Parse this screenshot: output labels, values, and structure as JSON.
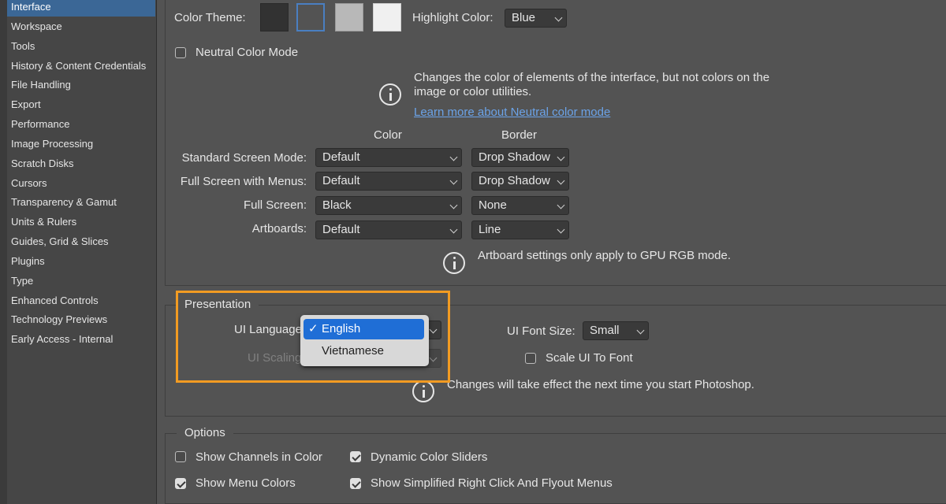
{
  "sidebar": {
    "items": [
      {
        "label": "Interface",
        "selected": true
      },
      {
        "label": "Workspace"
      },
      {
        "label": "Tools"
      },
      {
        "label": "History & Content Credentials"
      },
      {
        "label": "File Handling"
      },
      {
        "label": "Export"
      },
      {
        "label": "Performance"
      },
      {
        "label": "Image Processing"
      },
      {
        "label": "Scratch Disks"
      },
      {
        "label": "Cursors"
      },
      {
        "label": "Transparency & Gamut"
      },
      {
        "label": "Units & Rulers"
      },
      {
        "label": "Guides, Grid & Slices"
      },
      {
        "label": "Plugins"
      },
      {
        "label": "Type"
      },
      {
        "label": "Enhanced Controls"
      },
      {
        "label": "Technology Previews"
      },
      {
        "label": "Early Access - Internal"
      }
    ]
  },
  "appearance": {
    "color_theme_label": "Color Theme:",
    "theme_swatches": [
      "#323232",
      "#535353",
      "#b8b8b8",
      "#f0f0f0"
    ],
    "selected_theme_index": 1,
    "highlight_color_label": "Highlight Color:",
    "highlight_color_value": "Blue",
    "neutral_color_mode_label": "Neutral Color Mode",
    "neutral_color_mode_checked": false,
    "neutral_info_line1": "Changes the color of elements of the interface, but not colors on the",
    "neutral_info_line2": "image or color utilities.",
    "neutral_learn_more": "Learn more about Neutral color mode",
    "color_header": "Color",
    "border_header": "Border",
    "rows": [
      {
        "label": "Standard Screen Mode:",
        "color": "Default",
        "border": "Drop Shadow"
      },
      {
        "label": "Full Screen with Menus:",
        "color": "Default",
        "border": "Drop Shadow"
      },
      {
        "label": "Full Screen:",
        "color": "Black",
        "border": "None"
      },
      {
        "label": "Artboards:",
        "color": "Default",
        "border": "Line"
      }
    ],
    "artboard_note": "Artboard settings only apply to GPU RGB mode."
  },
  "presentation": {
    "legend": "Presentation",
    "ui_language_label": "UI Language:",
    "ui_scaling_label": "UI Scaling:",
    "language_menu": {
      "options": [
        "English",
        "Vietnamese"
      ],
      "selected": "English"
    },
    "ui_font_size_label": "UI Font Size:",
    "ui_font_size_value": "Small",
    "scale_ui_to_font_label": "Scale UI To Font",
    "scale_ui_to_font_checked": false,
    "restart_note": "Changes will take effect the next time you start Photoshop."
  },
  "options": {
    "legend": "Options",
    "show_channels_in_color": {
      "label": "Show Channels in Color",
      "checked": false
    },
    "dynamic_color_sliders": {
      "label": "Dynamic Color Sliders",
      "checked": true
    },
    "show_menu_colors": {
      "label": "Show Menu Colors",
      "checked": true
    },
    "show_simplified_menus": {
      "label": "Show Simplified Right Click And Flyout Menus",
      "checked": true
    }
  },
  "colors": {
    "background": "#535353",
    "sidebar": "#464646",
    "selection": "#3b6796",
    "menu_highlight": "#1f6ed6",
    "annotation_box": "#f29b22",
    "link": "#6ba3e8"
  }
}
